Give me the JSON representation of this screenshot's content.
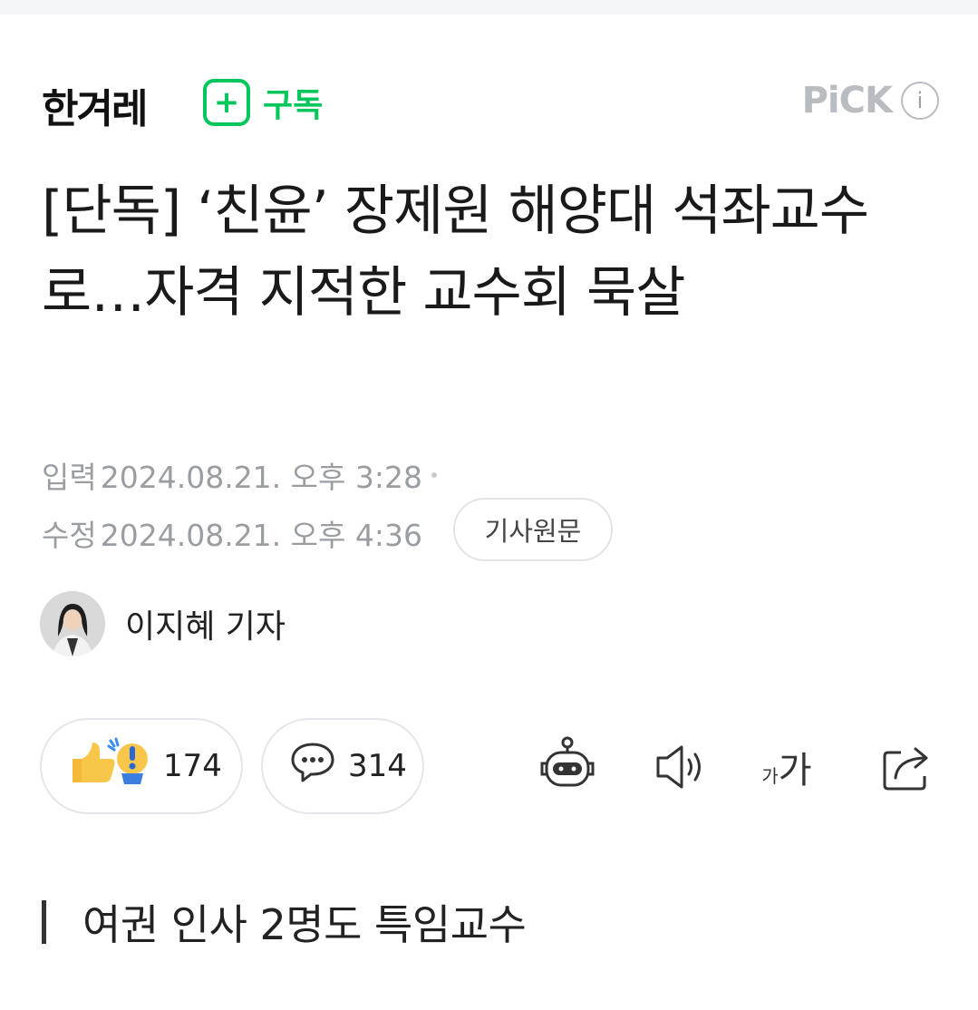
{
  "brand": {
    "logo_text": "한겨레",
    "subscribe_icon": "plus-icon",
    "subscribe_label": "구독",
    "pick_label": "PiCK",
    "pick_info_icon": "info-icon",
    "accent_color": "#03c75a"
  },
  "article": {
    "headline": "[단독] ‘친윤’ 장제원 해양대 석좌교수로…자격 지적한 교수회 묵살",
    "published_label": "입력",
    "published": "2024.08.21. 오후 3:28",
    "modified_label": "수정",
    "modified": "2024.08.21. 오후 4:36",
    "original_link": "기사원문",
    "reporter": "이지혜 기자",
    "subheading": "여권 인사 2명도 특임교수"
  },
  "reactions": {
    "like_count": "174",
    "comment_count": "314"
  },
  "toolbar": {
    "font_size_label_small": "가",
    "font_size_label_large": "가",
    "icons": [
      "robot-summary-icon",
      "speaker-icon",
      "font-size-icon",
      "share-icon"
    ]
  }
}
